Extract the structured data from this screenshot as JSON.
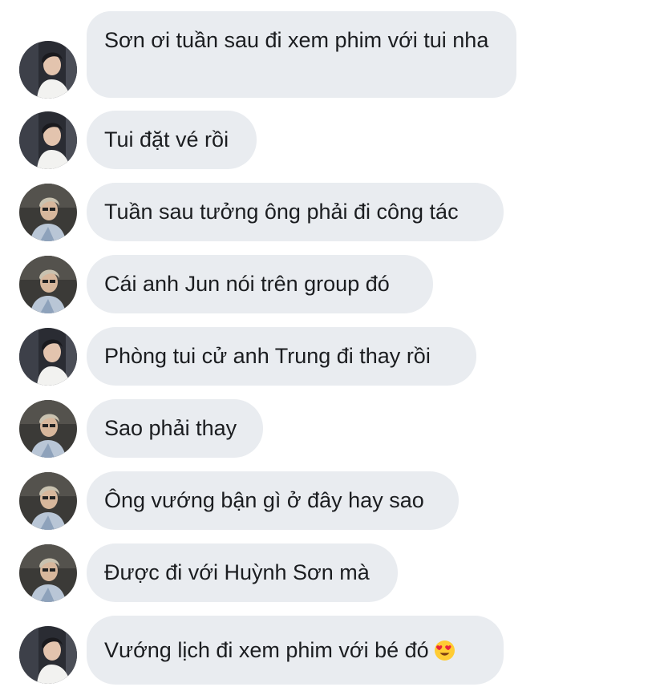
{
  "conversation": {
    "messages": [
      {
        "sender": "huynh-son",
        "text": "Sơn ơi tuần sau đi xem phim với tui nha"
      },
      {
        "sender": "huynh-son",
        "text": "Tui đặt vé rồi"
      },
      {
        "sender": "friend",
        "text": "Tuần sau tưởng ông phải đi công tác"
      },
      {
        "sender": "friend",
        "text": "Cái anh Jun nói trên group đó"
      },
      {
        "sender": "huynh-son",
        "text": "Phòng tui cử anh Trung đi thay rồi"
      },
      {
        "sender": "friend",
        "text": "Sao phải thay"
      },
      {
        "sender": "friend",
        "text": "Ông vướng bận gì ở đây hay sao"
      },
      {
        "sender": "friend",
        "text": "Được đi với Huỳnh Sơn mà"
      },
      {
        "sender": "huynh-son",
        "text": "Vướng lịch đi xem phim với bé đó",
        "emoji": "heart-eyes-emoji"
      }
    ]
  },
  "colors": {
    "bubble_background": "#e9ecf0",
    "text": "#1b1d20",
    "page_background": "#ffffff"
  }
}
